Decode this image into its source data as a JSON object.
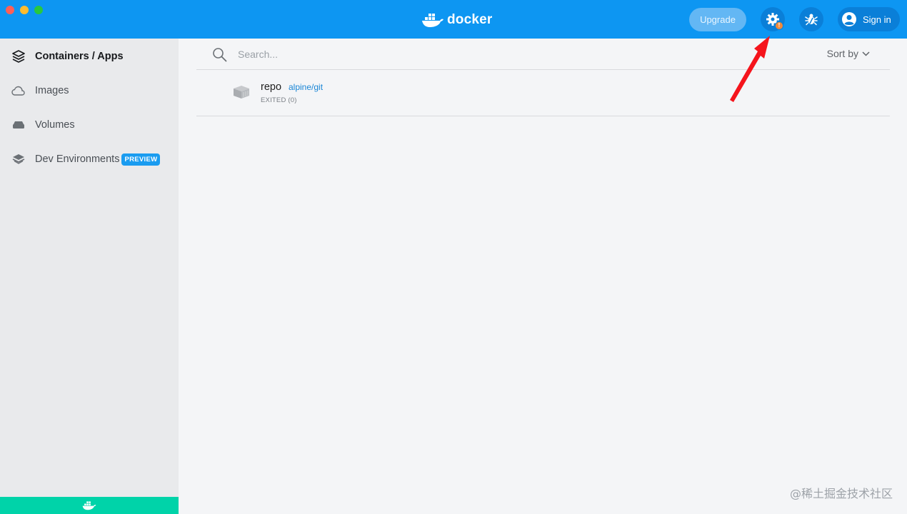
{
  "header": {
    "brand": "docker",
    "upgrade_label": "Upgrade",
    "settings_badge": "!",
    "signin_label": "Sign in",
    "accent_color": "#0d96f2"
  },
  "sidebar": {
    "items": [
      {
        "label": "Containers / Apps",
        "icon": "containers-icon",
        "active": true
      },
      {
        "label": "Images",
        "icon": "cloud-icon",
        "active": false
      },
      {
        "label": "Volumes",
        "icon": "volume-icon",
        "active": false
      },
      {
        "label": "Dev Environments",
        "icon": "dev-env-icon",
        "active": false,
        "badge": "PREVIEW"
      }
    ],
    "footer_color": "#00d3a9"
  },
  "main": {
    "search": {
      "placeholder": "Search..."
    },
    "sort_label": "Sort by",
    "containers": [
      {
        "name": "repo",
        "image": "alpine/git",
        "status": "EXITED (0)"
      }
    ]
  },
  "watermark": "@稀土掘金技术社区"
}
